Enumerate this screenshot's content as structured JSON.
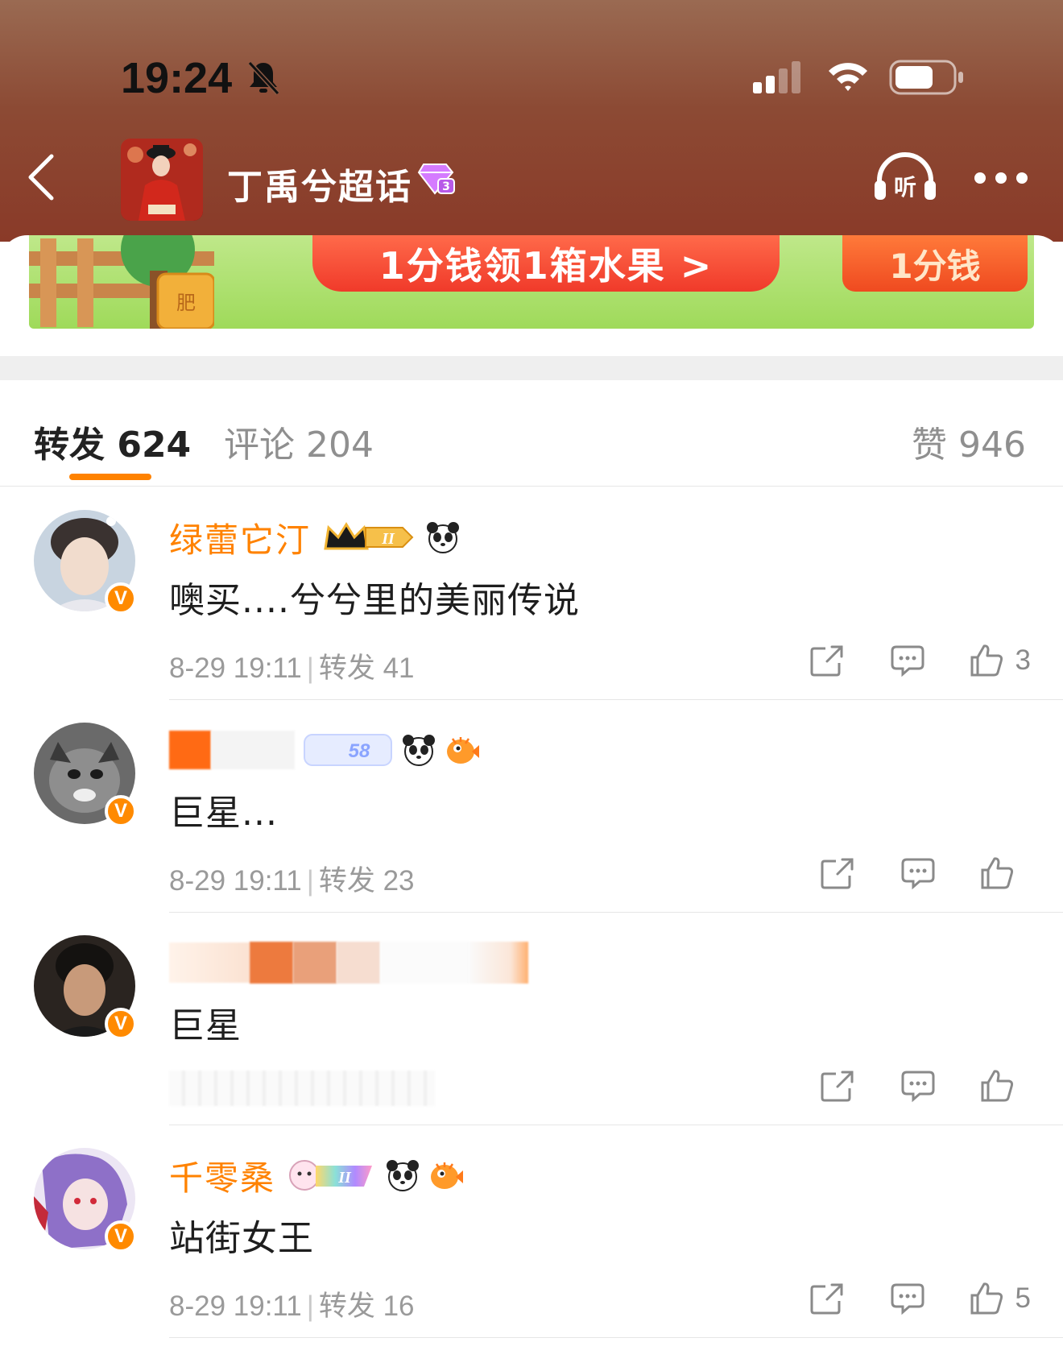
{
  "status_bar": {
    "time": "19:24"
  },
  "header": {
    "topic_title": "丁禹兮超话"
  },
  "banner": {
    "main_text": "1分钱领1箱水果 >",
    "badge_text": "1分钱",
    "pot_label": "肥"
  },
  "tabs": {
    "repost": {
      "label": "转发",
      "count": "624"
    },
    "comment": {
      "label": "评论",
      "count": "204"
    },
    "like": {
      "label": "赞",
      "count": "946"
    }
  },
  "items": [
    {
      "username": "绿蕾它汀",
      "content": "噢买....兮兮里的美丽传说",
      "date": "8-29 19:11",
      "repost_label": "转发 41",
      "like_count": "3",
      "badge_text": "II"
    },
    {
      "username": "",
      "content": "巨星...",
      "date": "8-29 19:11",
      "repost_label": "转发 23",
      "like_count": "",
      "badge_text": "58"
    },
    {
      "username": "",
      "content": "巨星",
      "date": "",
      "repost_label": "",
      "like_count": ""
    },
    {
      "username": "千零桑",
      "content": "站街女王",
      "date": "8-29 19:11",
      "repost_label": "转发 16",
      "like_count": "5",
      "badge_text": "II"
    }
  ],
  "icons": {
    "bell": "bell-slash-icon",
    "signal": "signal-icon",
    "wifi": "wifi-icon",
    "battery": "battery-icon",
    "back": "chevron-left-icon",
    "gem": "gem-badge-icon",
    "listen": "headphones-icon",
    "more": "more-dots-icon",
    "share": "share-icon",
    "comment": "comment-icon",
    "like": "thumbs-up-icon"
  },
  "colors": {
    "accent": "#ff8200",
    "header_bg": "#8c4a34",
    "verified": "#ff8a00"
  }
}
